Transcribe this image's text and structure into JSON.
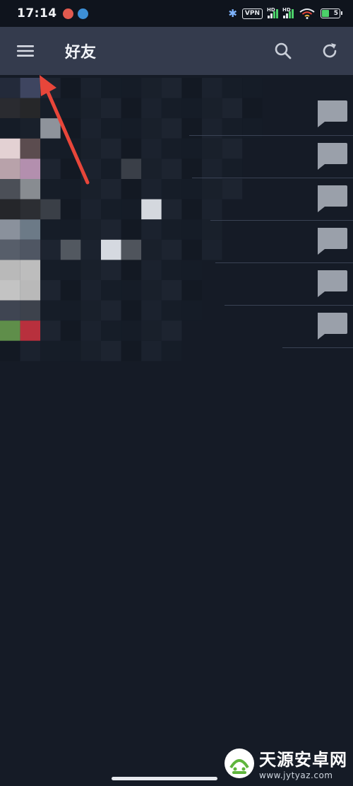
{
  "status_bar": {
    "time": "17:14",
    "vpn_label": "VPN",
    "signal_labels": [
      "HD",
      "HD"
    ],
    "battery_level": "5"
  },
  "app_bar": {
    "title": "好友",
    "menu_icon": "hamburger-menu-icon",
    "search_icon": "search-icon",
    "refresh_icon": "refresh-icon"
  },
  "friend_list": {
    "rows": [
      {
        "action_icon": "chat-bubble-icon"
      },
      {
        "action_icon": "chat-bubble-icon"
      },
      {
        "action_icon": "chat-bubble-icon"
      },
      {
        "action_icon": "chat-bubble-icon"
      },
      {
        "action_icon": "chat-bubble-icon"
      },
      {
        "action_icon": "chat-bubble-icon"
      }
    ]
  },
  "colors": {
    "background": "#151b26",
    "app_bar": "#343b4d",
    "status_bar": "#0f141d",
    "annotation_arrow": "#e8463a",
    "chat_icon": "#9aa0aa"
  },
  "watermark": {
    "name": "天源安卓网",
    "url": "www.jytyaz.com"
  }
}
